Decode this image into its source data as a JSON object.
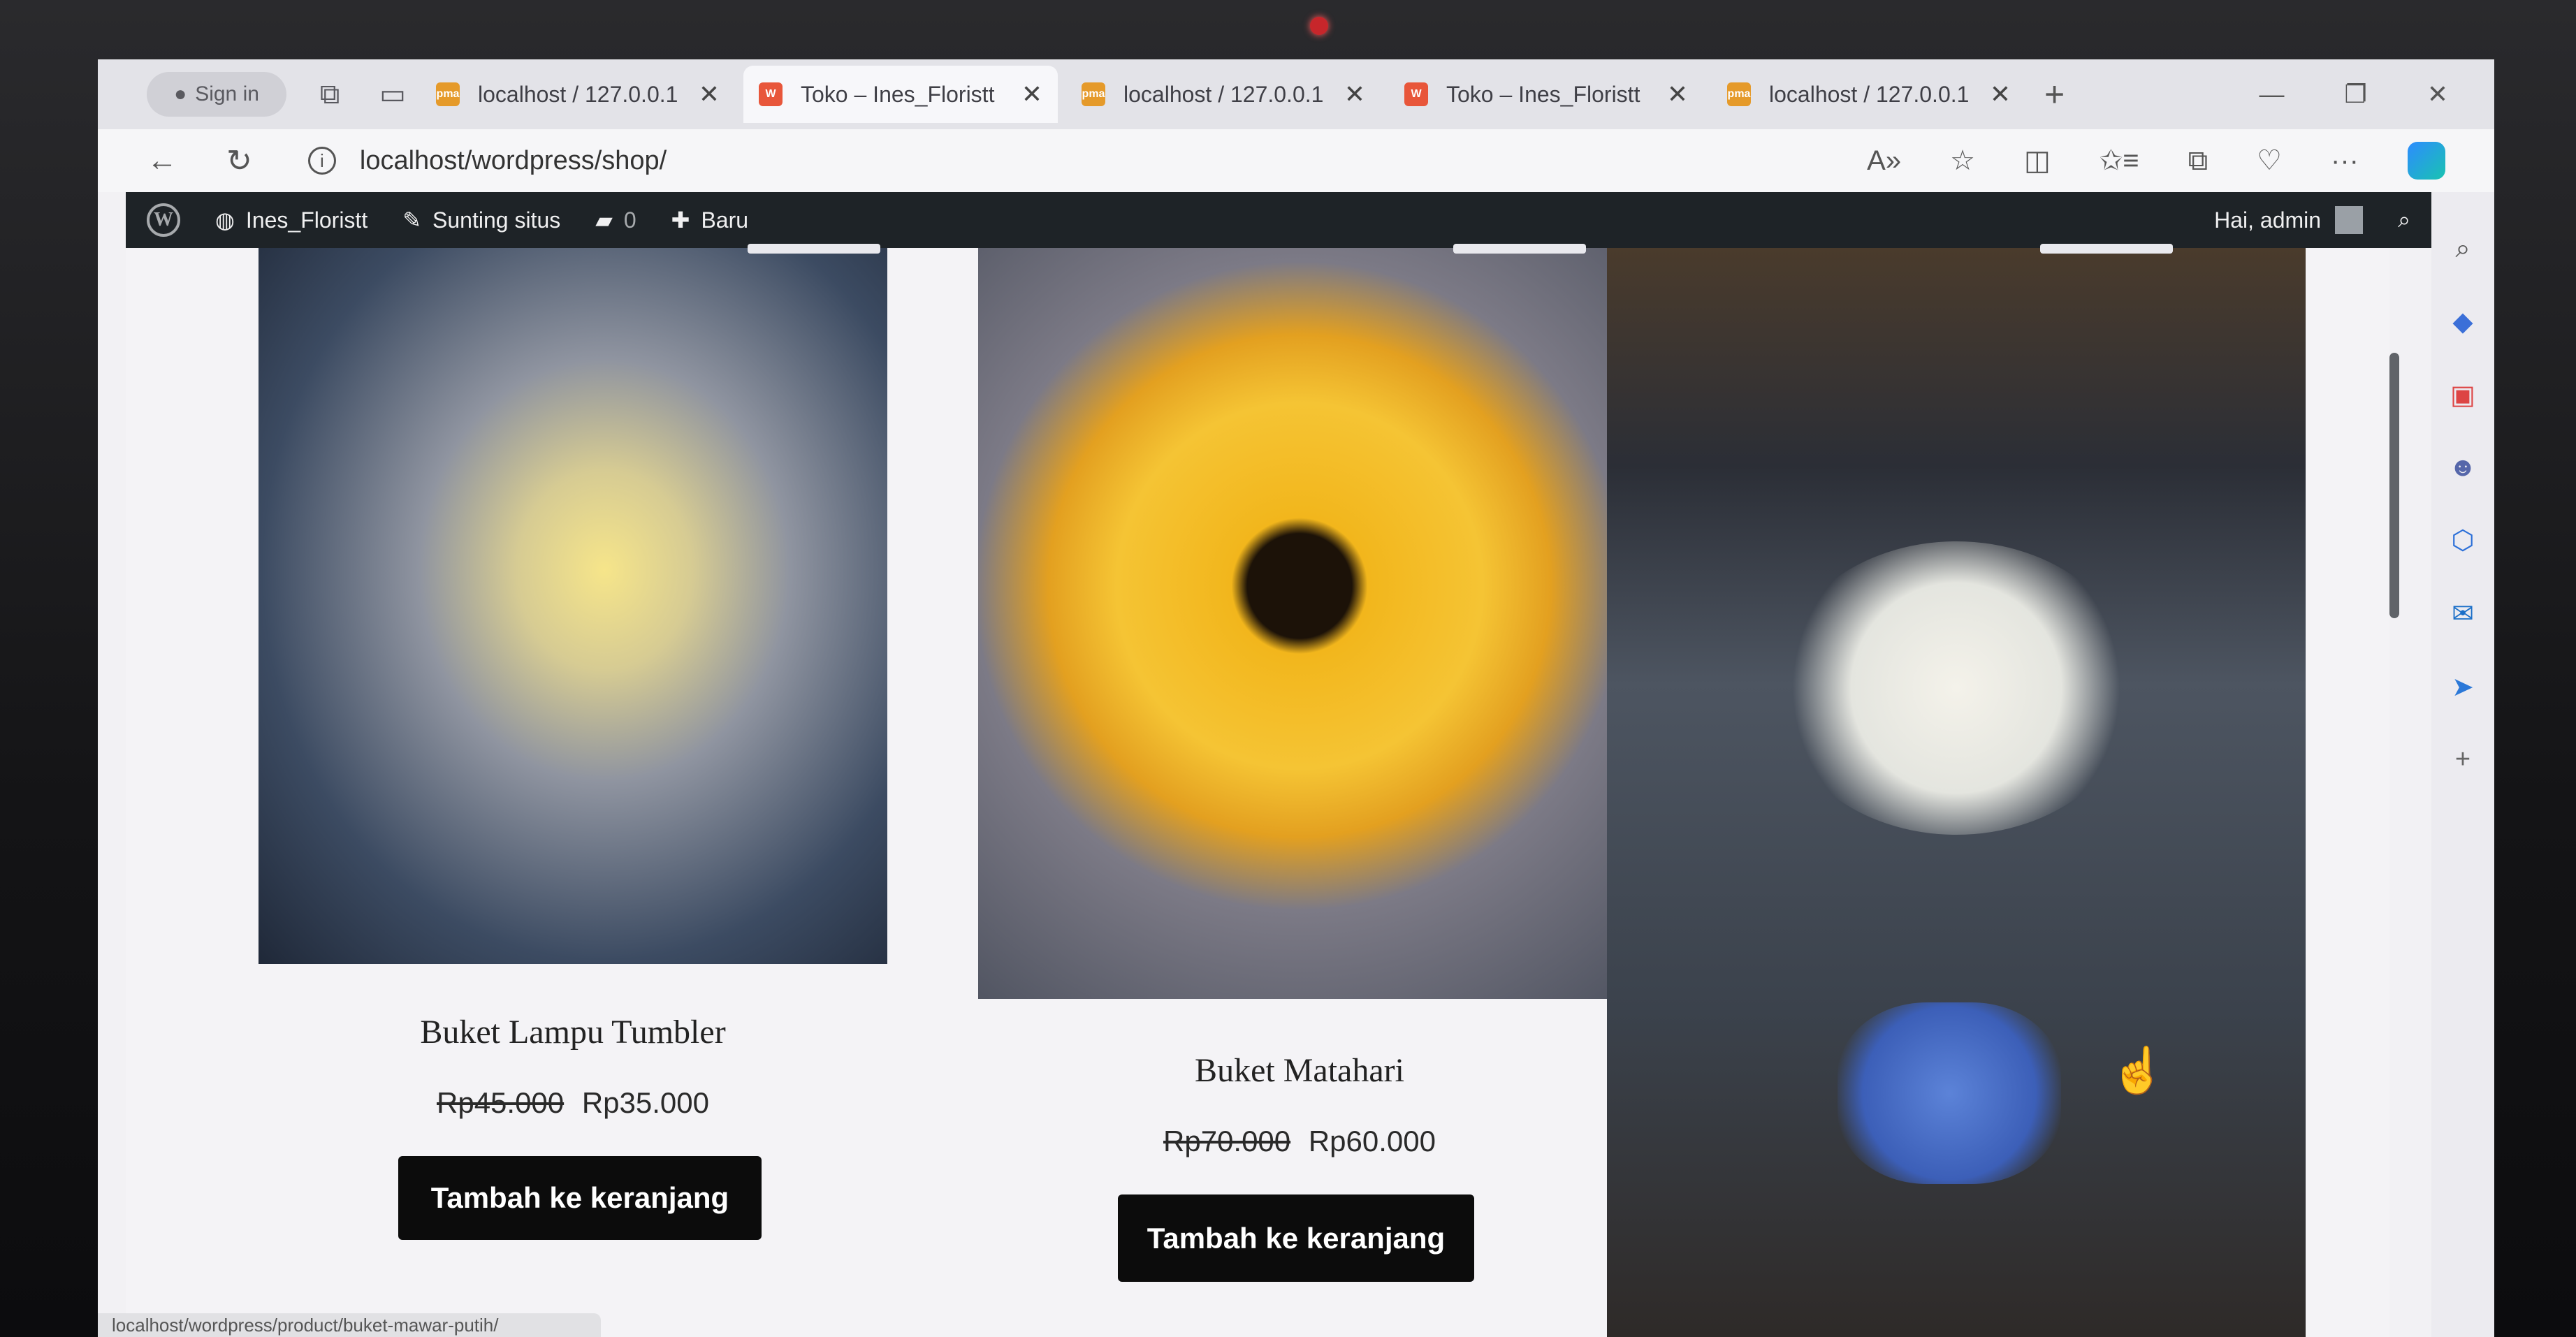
{
  "browser": {
    "signin_label": "Sign in",
    "tabs": [
      {
        "label": "localhost / 127.0.0.1",
        "icon": "pma",
        "active": false
      },
      {
        "label": "Toko – Ines_Floristt",
        "icon": "woo",
        "active": true
      },
      {
        "label": "localhost / 127.0.0.1",
        "icon": "pma",
        "active": false
      },
      {
        "label": "Toko – Ines_Floristt",
        "icon": "woo",
        "active": false
      },
      {
        "label": "localhost / 127.0.0.1",
        "icon": "pma",
        "active": false
      }
    ],
    "url": "localhost/wordpress/shop/",
    "status_url": "localhost/wordpress/product/buket-mawar-putih/"
  },
  "adminbar": {
    "site_name": "Ines_Floristt",
    "customize": "Sunting situs",
    "comments": "0",
    "new": "Baru",
    "greeting": "Hai, admin"
  },
  "products": [
    {
      "name": "Buket Lampu Tumbler",
      "old_price": "Rp45.000",
      "price": "Rp35.000",
      "button": "Tambah ke keranjang"
    },
    {
      "name": "Buket Matahari",
      "old_price": "Rp70.000",
      "price": "Rp60.000",
      "button": "Tambah ke keranjang"
    }
  ],
  "colors": {
    "adminbar": "#1e2327",
    "button": "#0c0c0c",
    "accent_red": "#c7262b"
  }
}
